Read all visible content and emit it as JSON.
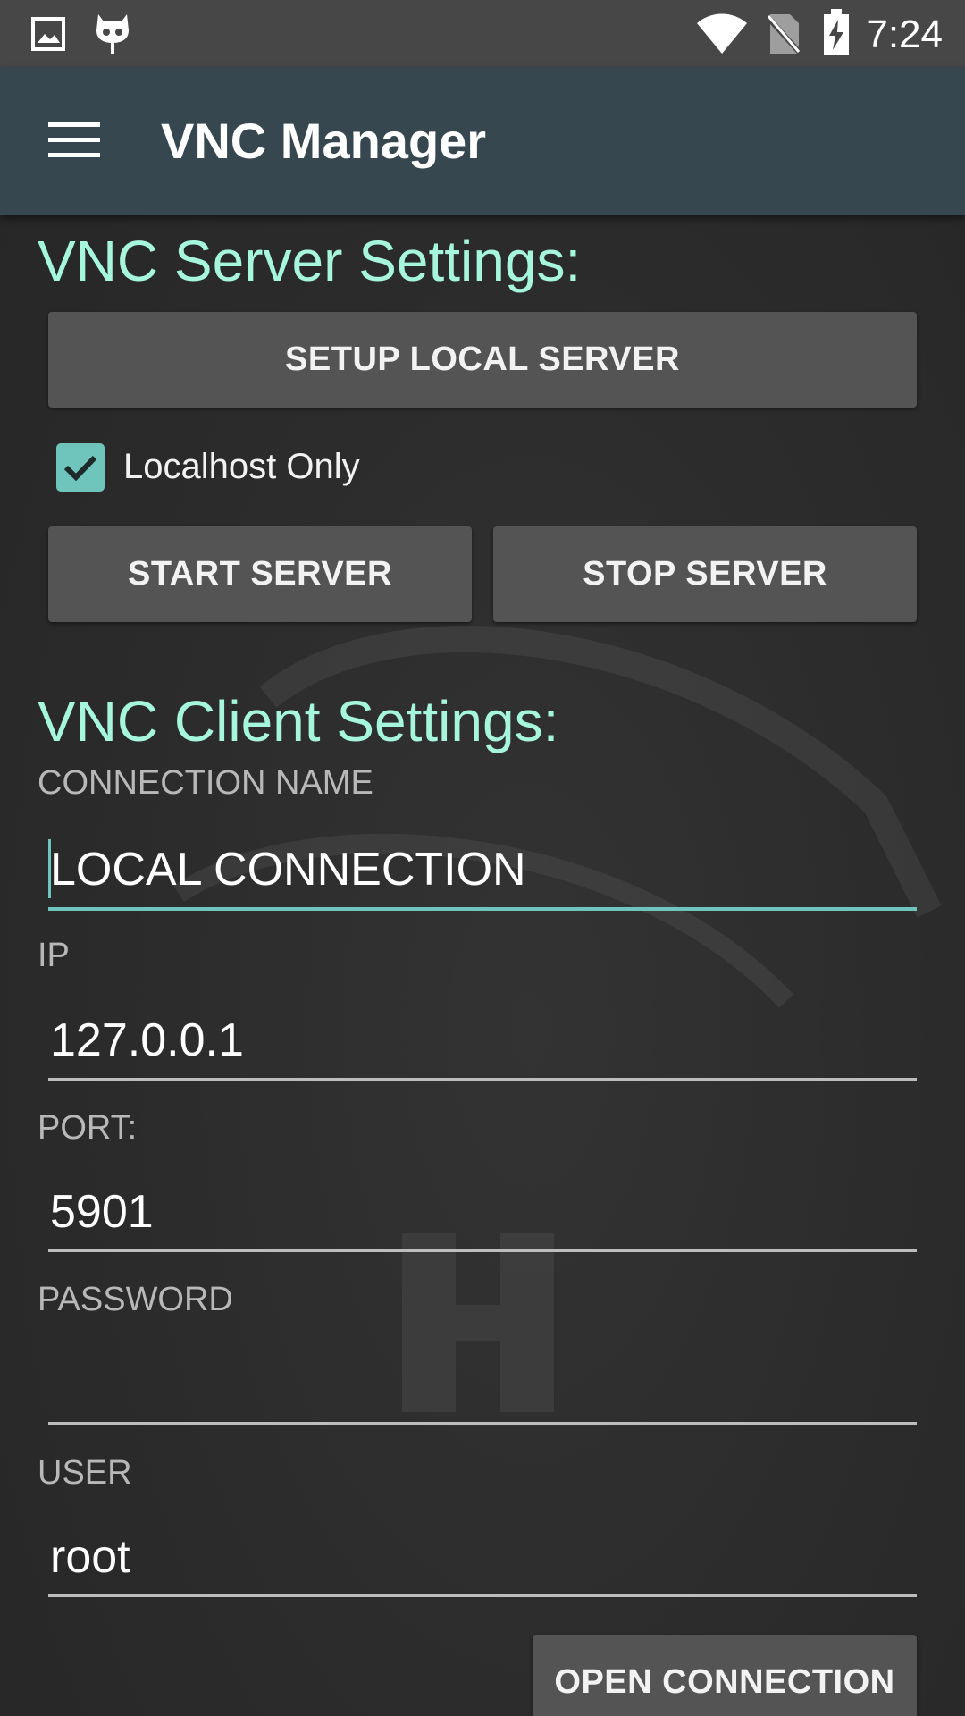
{
  "status_bar": {
    "time": "7:24",
    "icons": [
      "image-icon",
      "cyanogen-icon",
      "wifi-icon",
      "no-sim-icon",
      "battery-charging-icon"
    ]
  },
  "app_bar": {
    "title": "VNC Manager",
    "menu_icon": "hamburger-menu-icon"
  },
  "server_section": {
    "title": "VNC Server Settings:",
    "setup_button": "SETUP LOCAL SERVER",
    "localhost_only": {
      "label": "Localhost Only",
      "checked": true
    },
    "start_button": "START SERVER",
    "stop_button": "STOP SERVER"
  },
  "client_section": {
    "title": "VNC Client Settings:",
    "connection_name": {
      "label": "CONNECTION NAME",
      "value": "LOCAL CONNECTION"
    },
    "ip": {
      "label": "IP",
      "value": "127.0.0.1"
    },
    "port": {
      "label": "PORT:",
      "value": "5901"
    },
    "password": {
      "label": "PASSWORD",
      "value": ""
    },
    "user": {
      "label": "USER",
      "value": "root"
    },
    "open_button": "OPEN CONNECTION"
  },
  "colors": {
    "accent": "#a6f5dd",
    "checkbox": "#6fc4bc",
    "app_bar": "#37474f",
    "status_bar": "#474747",
    "button": "#545454",
    "background": "#2b2b2b"
  }
}
